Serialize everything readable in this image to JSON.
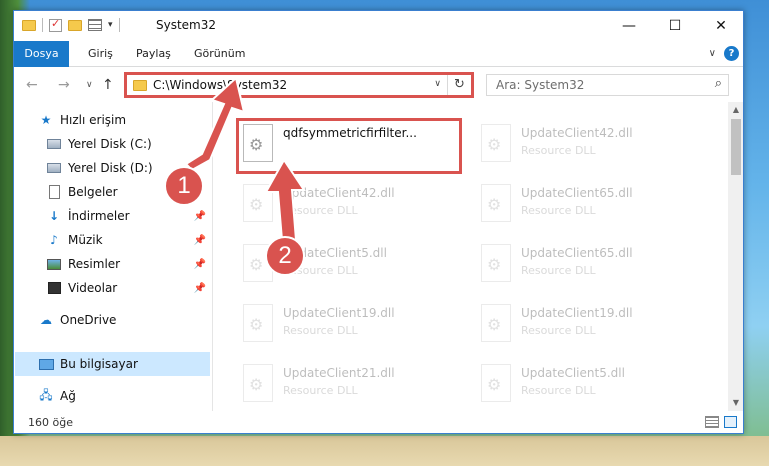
{
  "window": {
    "title": "System32",
    "controls": {
      "minimize": "—",
      "maximize": "☐",
      "close": "✕"
    }
  },
  "ribbon": {
    "tabs": [
      {
        "label": "Dosya"
      },
      {
        "label": "Giriş"
      },
      {
        "label": "Paylaş"
      },
      {
        "label": "Görünüm"
      }
    ],
    "help": "?"
  },
  "nav": {
    "address": "C:\\Windows\\System32",
    "search_placeholder": "Ara: System32"
  },
  "sidebar": {
    "items": [
      {
        "label": "Hızlı erişim",
        "icon": "star-icon"
      },
      {
        "label": "Yerel Disk (C:)",
        "icon": "drive-icon",
        "pinned": true
      },
      {
        "label": "Yerel Disk (D:)",
        "icon": "drive-icon",
        "pinned": true
      },
      {
        "label": "Belgeler",
        "icon": "document-icon",
        "pinned": true
      },
      {
        "label": "İndirmeler",
        "icon": "download-icon",
        "pinned": true
      },
      {
        "label": "Müzik",
        "icon": "music-icon",
        "pinned": true
      },
      {
        "label": "Resimler",
        "icon": "pictures-icon",
        "pinned": true
      },
      {
        "label": "Videolar",
        "icon": "videos-icon",
        "pinned": true
      },
      {
        "label": "OneDrive",
        "icon": "cloud-icon"
      },
      {
        "label": "Bu bilgisayar",
        "icon": "computer-icon",
        "selected": true
      },
      {
        "label": "Ağ",
        "icon": "network-icon"
      }
    ]
  },
  "files": [
    {
      "name": "qdfsymmetricfirfilter...",
      "type": ""
    },
    {
      "name": "UpdateClient42.dll",
      "type": "Resource DLL"
    },
    {
      "name": "UpdateClient42.dll",
      "type": "Resource DLL"
    },
    {
      "name": "UpdateClient65.dll",
      "type": "Resource DLL"
    },
    {
      "name": "UpdateClient5.dll",
      "type": "Resource DLL"
    },
    {
      "name": "UpdateClient65.dll",
      "type": "Resource DLL"
    },
    {
      "name": "UpdateClient19.dll",
      "type": "Resource DLL"
    },
    {
      "name": "UpdateClient19.dll",
      "type": "Resource DLL"
    },
    {
      "name": "UpdateClient21.dll",
      "type": "Resource DLL"
    },
    {
      "name": "UpdateClient5.dll",
      "type": "Resource DLL"
    }
  ],
  "status": {
    "item_count": "160 öğe"
  },
  "annotations": {
    "badge1": "1",
    "badge2": "2",
    "color": "#d9534f"
  }
}
